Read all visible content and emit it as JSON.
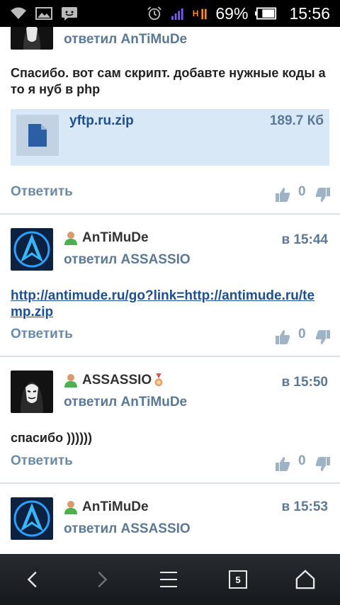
{
  "statusbar": {
    "battery_percent": "69%",
    "time": "15:56",
    "network_label": "H"
  },
  "posts": [
    {
      "replied": "ответил AnTiMuDe",
      "text": "Спасибо. вот сам скрипт. добавте нужные коды а то я нуб в php",
      "attachment": {
        "name": "yftp.ru.zip",
        "size": "189.7 Кб"
      },
      "reply_label": "Ответить",
      "likes": "0"
    },
    {
      "author": "AnTiMuDe",
      "replied": "ответил ASSASSIO",
      "time": "в 15:44",
      "link": "http://antimude.ru/go?link=http://antimude.ru/temp.zip",
      "reply_label": "Ответить",
      "likes": "0"
    },
    {
      "author": "ASSASSIO",
      "replied": "ответил AnTiMuDe",
      "time": "в 15:50",
      "text": "спасибо ))))))",
      "reply_label": "Ответить",
      "likes": "0"
    },
    {
      "author": "AnTiMuDe",
      "replied": "ответил ASSASSIO",
      "time": "в 15:53"
    }
  ],
  "navbar": {
    "tabs_count": "5"
  }
}
